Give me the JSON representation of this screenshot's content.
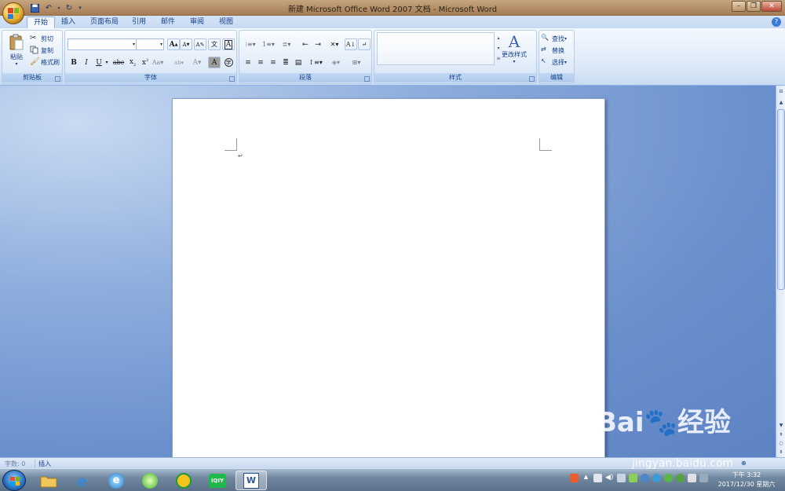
{
  "window": {
    "title": "新建 Microsoft Office Word 2007 文档 - Microsoft Word"
  },
  "tabs": [
    "开始",
    "插入",
    "页面布局",
    "引用",
    "邮件",
    "审阅",
    "视图"
  ],
  "active_tab": "开始",
  "ribbon": {
    "clipboard": {
      "paste": "粘贴",
      "cut": "剪切",
      "copy": "复制",
      "format_painter": "格式刷",
      "group": "剪贴板"
    },
    "font": {
      "font_name": "",
      "font_size": "",
      "group": "字体",
      "bold": "B",
      "italic": "I",
      "underline": "U",
      "strike": "abc",
      "grow": "A",
      "shrink": "A"
    },
    "paragraph": {
      "group": "段落"
    },
    "styles": {
      "change_styles": "更改样式",
      "group": "样式"
    },
    "editing": {
      "find": "查找",
      "replace": "替换",
      "select": "选择",
      "group": "编辑"
    }
  },
  "statusbar": {
    "word_count": "字数: 0",
    "mode": "插入"
  },
  "taskbar": {
    "clock_time": "下午 3:32",
    "clock_date": "2017/12/30 星期六"
  },
  "watermark": {
    "brand": "Bai",
    "brand2": "经验",
    "url": "jingyan.baidu.com"
  },
  "colors": {
    "ribbon_text": "#15428b",
    "title_bar": "#b58c62",
    "document_bg": "#6d8fc9"
  }
}
